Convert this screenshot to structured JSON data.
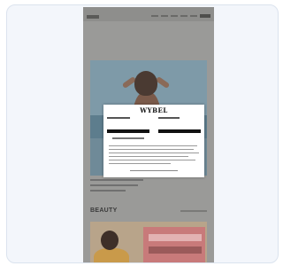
{
  "consent_dialog": {
    "brand": "WYBEL"
  },
  "sections": {
    "beauty_heading": "BEAUTY"
  }
}
